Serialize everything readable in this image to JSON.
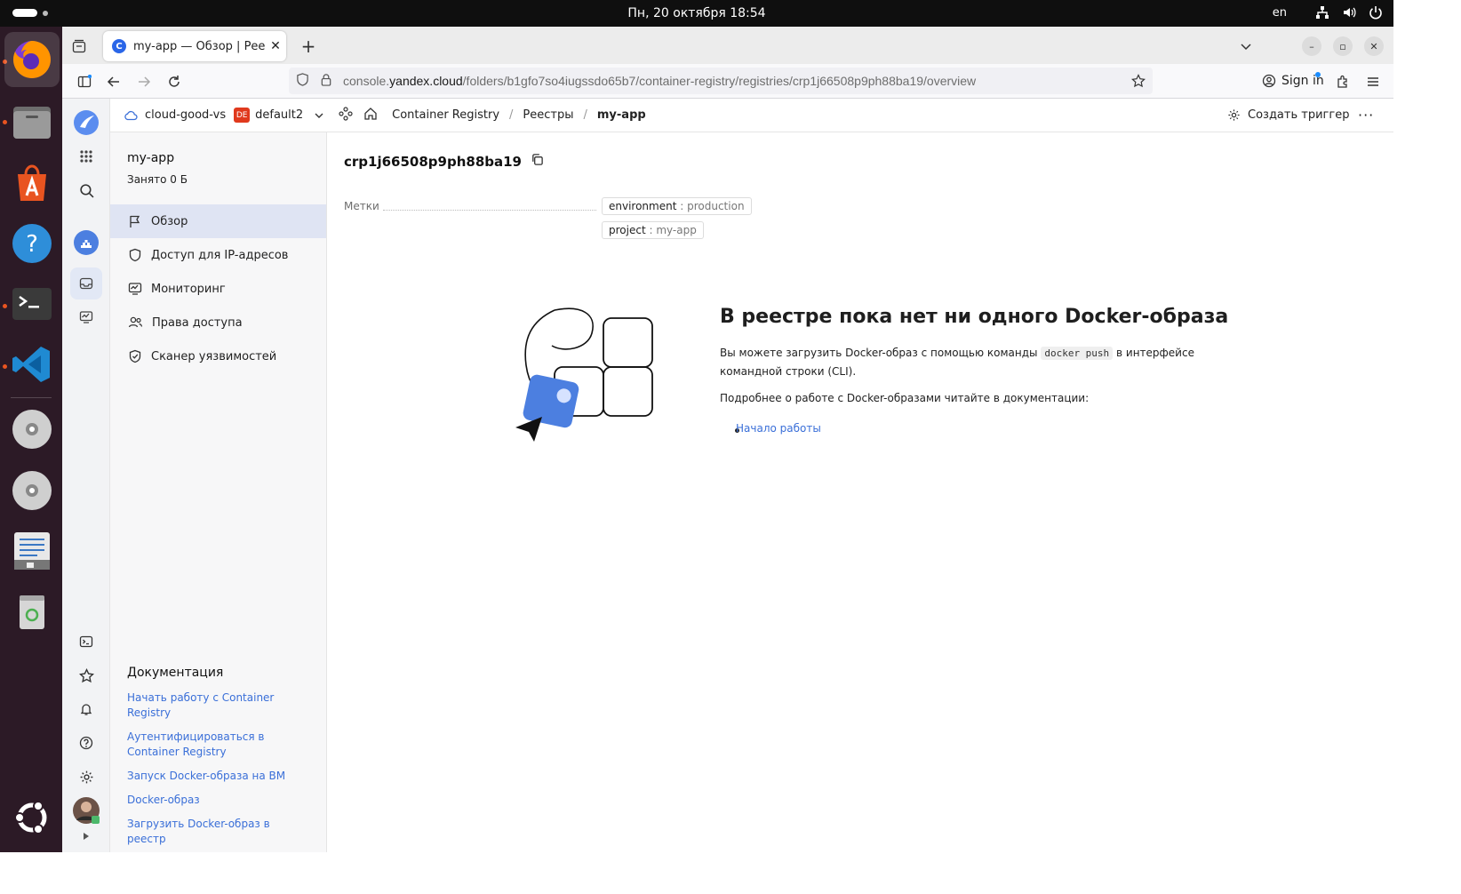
{
  "system": {
    "clock": "Пн, 20 октября  18:54",
    "language": "en"
  },
  "dock": {
    "apps": [
      "firefox",
      "files",
      "app-center",
      "help",
      "terminal",
      "vscode",
      "disc",
      "disc",
      "text-editor",
      "trash"
    ]
  },
  "browser": {
    "tab_title": "my-app — Обзор | Реестр",
    "url_prefix": "console.",
    "url_domain": "yandex.cloud",
    "url_path": "/folders/b1gfo7so4iugssdo65b7/container-registry/registries/crp1j66508p9ph88ba19/overview",
    "signin": "Sign in"
  },
  "console": {
    "cloud": "cloud-good-vs",
    "folder_badge": "DE",
    "folder": "default2",
    "breadcrumbs": [
      "Container Registry",
      "Реестры",
      "my-app"
    ],
    "create_trigger": "Создать триггер"
  },
  "sidebar": {
    "registry_name": "my-app",
    "used": "Занято 0 Б",
    "items": [
      {
        "label": "Обзор",
        "icon": "flag-icon"
      },
      {
        "label": "Доступ для IP-адресов",
        "icon": "shield-icon"
      },
      {
        "label": "Мониторинг",
        "icon": "monitor-icon"
      },
      {
        "label": "Права доступа",
        "icon": "users-icon"
      },
      {
        "label": "Сканер уязвимостей",
        "icon": "shield-check-icon"
      }
    ],
    "docs_title": "Документация",
    "doc_links": [
      "Начать работу с Container Registry",
      "Аутентифицироваться в Container Registry",
      "Запуск Docker-образа на ВМ",
      "Docker-образ",
      "Загрузить Docker-образ в реестр"
    ]
  },
  "main": {
    "registry_id": "crp1j66508p9ph88ba19",
    "labels_key": "Метки",
    "labels": [
      {
        "key": "environment",
        "value": "production"
      },
      {
        "key": "project",
        "value": "my-app"
      }
    ],
    "empty_title": "В реестре пока нет ни одного Docker-образа",
    "empty_text_1": "Вы можете загрузить Docker-образ с помощью команды",
    "empty_code": "docker push",
    "empty_text_2": "в интерфейсе командной строки (CLI).",
    "empty_more": "Подробнее о работе с Docker-образами читайте в документации:",
    "empty_link": "Начало работы"
  }
}
